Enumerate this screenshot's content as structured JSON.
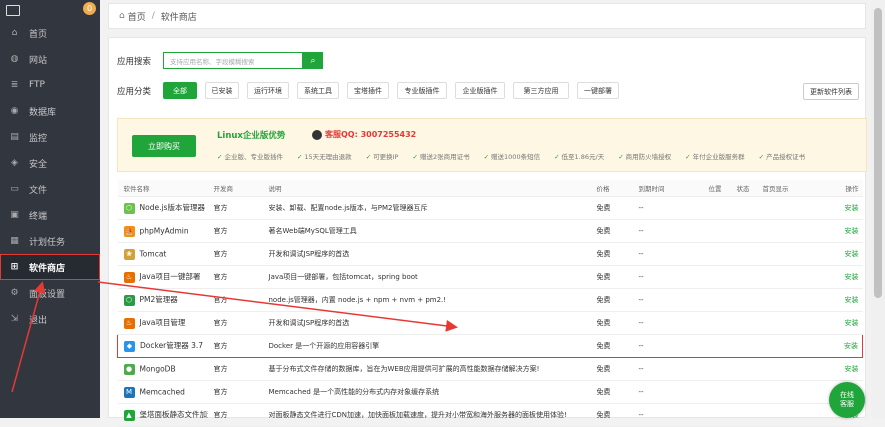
{
  "sidebar": {
    "badge": "0",
    "items": [
      {
        "label": "首页",
        "icon": "home-icon",
        "glyph": "⌂"
      },
      {
        "label": "网站",
        "icon": "globe-icon",
        "glyph": "◍"
      },
      {
        "label": "FTP",
        "icon": "ftp-icon",
        "glyph": "≣"
      },
      {
        "label": "数据库",
        "icon": "database-icon",
        "glyph": "◉"
      },
      {
        "label": "监控",
        "icon": "monitor-icon",
        "glyph": "▤"
      },
      {
        "label": "安全",
        "icon": "shield-icon",
        "glyph": "◈"
      },
      {
        "label": "文件",
        "icon": "folder-icon",
        "glyph": "▭"
      },
      {
        "label": "终端",
        "icon": "terminal-icon",
        "glyph": "▣"
      },
      {
        "label": "计划任务",
        "icon": "calendar-icon",
        "glyph": "▦"
      },
      {
        "label": "软件商店",
        "icon": "grid-icon",
        "glyph": "⊞"
      },
      {
        "label": "面板设置",
        "icon": "gear-icon",
        "glyph": "⚙"
      },
      {
        "label": "退出",
        "icon": "logout-icon",
        "glyph": "⇲"
      }
    ]
  },
  "breadcrumb": {
    "home": "首页",
    "current": "软件商店"
  },
  "search": {
    "label": "应用搜索",
    "placeholder": "支持应用名称、字段模糊搜索"
  },
  "categories": {
    "label": "应用分类",
    "items": [
      "全部",
      "已安装",
      "运行环境",
      "系统工具",
      "宝塔插件",
      "专业版插件",
      "企业版插件",
      "第三方应用",
      "一键部署"
    ],
    "update_label": "更新软件列表"
  },
  "promo": {
    "buy_label": "立即购买",
    "title": "Linux企业版优势",
    "qq": "客服QQ: 3007255432",
    "features": [
      "企业版、专业版插件",
      "15天无理由退款",
      "可更换IP",
      "赠送2张商用证书",
      "赠送1000条短信",
      "低至1.86元/天",
      "商用防火墙授权",
      "年付企业版服务群",
      "产品授权证书"
    ]
  },
  "table": {
    "headers": [
      "软件名称",
      "开发商",
      "说明",
      "价格",
      "到期时间",
      "位置",
      "状态",
      "首页显示",
      "操作"
    ],
    "rows": [
      {
        "name": "Node.js版本管理器",
        "dev": "官方",
        "desc": "安装、卸载、配置node.js版本，与PM2管理器互斥",
        "price": "免费",
        "expire": "--",
        "action": "安装",
        "icon_color": "#6cc24a",
        "glyph": "⬡"
      },
      {
        "name": "phpMyAdmin",
        "dev": "官方",
        "desc": "著名Web端MySQL管理工具",
        "price": "免费",
        "expire": "--",
        "action": "安装",
        "icon_color": "#f29111",
        "glyph": "⛵"
      },
      {
        "name": "Tomcat",
        "dev": "官方",
        "desc": "开发和调试JSP程序的首选",
        "price": "免费",
        "expire": "--",
        "action": "安装",
        "icon_color": "#d1a13b",
        "glyph": "❀"
      },
      {
        "name": "Java项目一键部署",
        "dev": "官方",
        "desc": "Java项目一键部署，包括tomcat，spring boot",
        "price": "免费",
        "expire": "--",
        "action": "安装",
        "icon_color": "#e76f00",
        "glyph": "♨"
      },
      {
        "name": "PM2管理器",
        "dev": "官方",
        "desc": "node.js管理器，内置 node.js + npm + nvm + pm2.!",
        "price": "免费",
        "expire": "--",
        "action": "安装",
        "icon_color": "#2b9b43",
        "glyph": "⬡"
      },
      {
        "name": "Java项目管理",
        "dev": "官方",
        "desc": "开发和调试JSP程序的首选",
        "price": "免费",
        "expire": "--",
        "action": "安装",
        "icon_color": "#e76f00",
        "glyph": "♨"
      },
      {
        "name": "Docker管理器 3.7",
        "dev": "官方",
        "desc": "Docker 是一个开源的应用容器引擎",
        "price": "免费",
        "expire": "--",
        "action": "安装",
        "icon_color": "#2496ed",
        "glyph": "◆"
      },
      {
        "name": "MongoDB",
        "dev": "官方",
        "desc": "基于分布式文件存储的数据库，旨在为WEB应用提供可扩展的高性能数据存储解决方案!",
        "price": "免费",
        "expire": "--",
        "action": "安装",
        "icon_color": "#4fa94d",
        "glyph": "●"
      },
      {
        "name": "Memcached",
        "dev": "官方",
        "desc": "Memcached 是一个高性能的分布式内存对象缓存系统",
        "price": "免费",
        "expire": "--",
        "action": "安装",
        "icon_color": "#1b75bb",
        "glyph": "M"
      },
      {
        "name": "堡塔面板静态文件加速",
        "dev": "官方",
        "desc": "对面板静态文件进行CDN加速，加快面板加载速度，提升对小带宽和海外服务器的面板使用体验!",
        "price": "免费",
        "expire": "--",
        "action": "安装",
        "icon_color": "#20a53a",
        "glyph": "▲"
      }
    ]
  },
  "fab": {
    "line1": "在线",
    "line2": "客服"
  }
}
